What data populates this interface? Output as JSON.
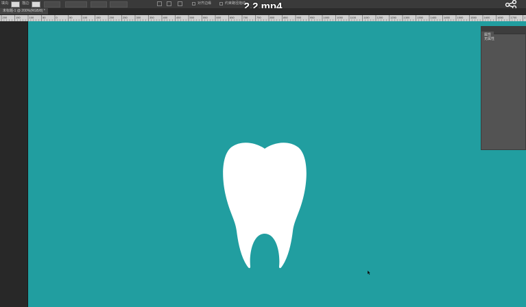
{
  "video": {
    "title": "2.2.mp4"
  },
  "optionsbar": {
    "fill_label": "填充:",
    "stroke_label": "描边:",
    "fill_color": "#d9d9d9",
    "stroke_color": "#dadada",
    "align_edges_label": "对齐边缘",
    "constrain_label": "约束路径拖动"
  },
  "document": {
    "tab_label": "未标题-1 @ 200%(RGB/8) *"
  },
  "ruler": {
    "labels": [
      "200",
      "150",
      "100",
      "50",
      "0",
      "50",
      "100",
      "150",
      "200",
      "250",
      "300",
      "350",
      "400",
      "450",
      "500",
      "550",
      "600",
      "650",
      "700",
      "750",
      "800",
      "850",
      "900",
      "950",
      "1000",
      "1050",
      "1100",
      "1150",
      "1200",
      "1250",
      "1300",
      "1350",
      "1400",
      "1450",
      "1500",
      "1550",
      "1600",
      "1650",
      "1700",
      "1750",
      "1800",
      "1850"
    ]
  },
  "canvas": {
    "background": "#219ea0",
    "shape_color": "#ffffff"
  },
  "properties_panel": {
    "tab_label": "属性",
    "body_text": "无属性"
  },
  "icons": [
    "share-icon",
    "tooth-shape",
    "mouse-cursor-icon"
  ]
}
